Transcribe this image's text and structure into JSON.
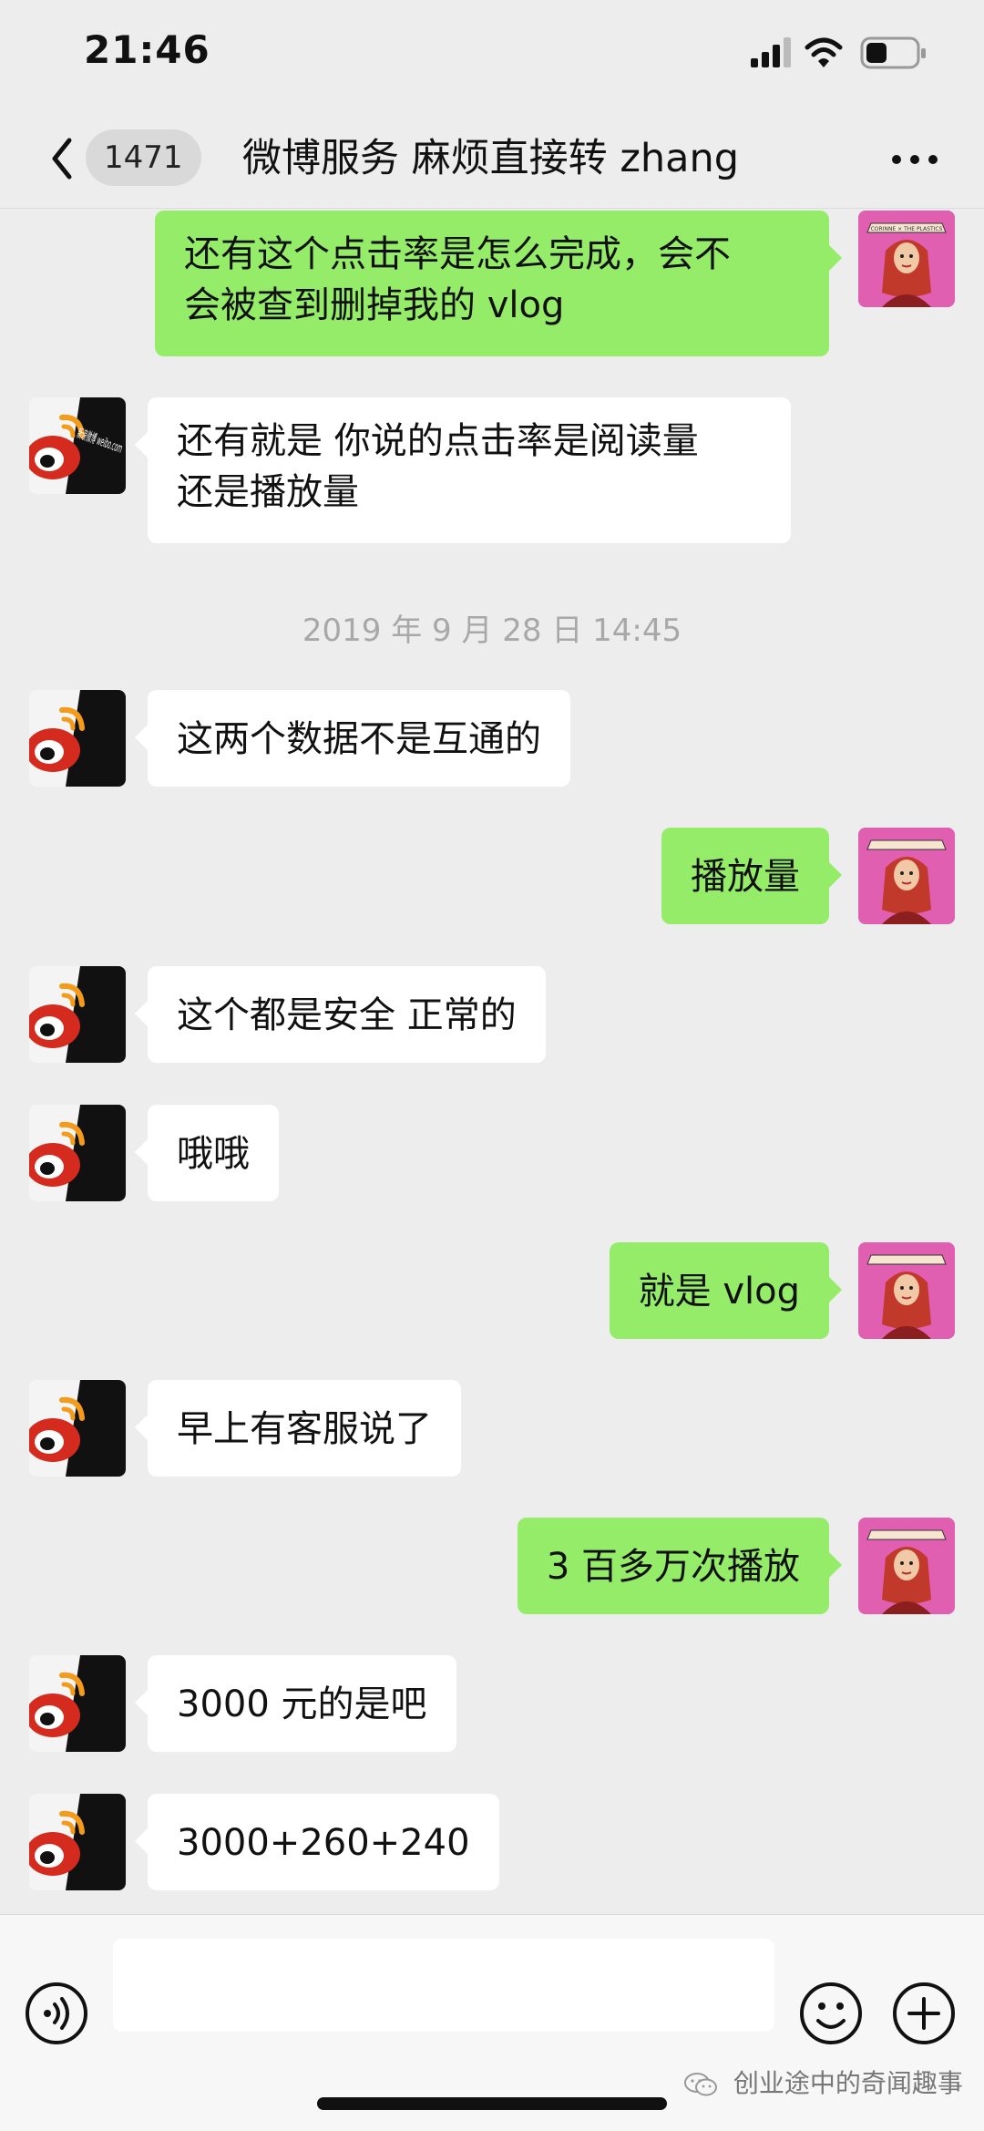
{
  "status_bar": {
    "time": "21:46"
  },
  "header": {
    "unread_count": "1471",
    "title": "微博服务 麻烦直接转 zhang"
  },
  "avatars": {
    "weibo_logo_text": "新浪微博 weibo.com",
    "self_logo_text": "CORINNE × THE PLASTICS"
  },
  "messages": [
    {
      "side": "out",
      "lines": [
        "还有这个点击率是怎么完成，会不",
        "会被查到删掉我的 vlog"
      ]
    },
    {
      "side": "in",
      "lines": [
        "还有就是 你说的点击率是阅读量",
        "还是播放量"
      ]
    },
    {
      "timestamp": "2019 年 9 月 28 日 14:45"
    },
    {
      "side": "in",
      "text": "这两个数据不是互通的"
    },
    {
      "side": "out",
      "text": "播放量"
    },
    {
      "side": "in",
      "text": "这个都是安全 正常的"
    },
    {
      "side": "in",
      "text": "哦哦"
    },
    {
      "side": "out",
      "text": "就是 vlog"
    },
    {
      "side": "in",
      "text": "早上有客服说了"
    },
    {
      "side": "out",
      "text": "3 百多万次播放"
    },
    {
      "side": "in",
      "text": "3000 元的是吧"
    },
    {
      "side": "in",
      "text": "3000+260+240"
    }
  ],
  "input_bar": {
    "value": ""
  },
  "watermark": {
    "text": "创业途中的奇闻趣事"
  },
  "colors": {
    "background": "#ededed",
    "bubble_out": "#95ec69",
    "bubble_in": "#ffffff",
    "self_avatar": "#e05fb1",
    "weibo_red": "#d52b1e",
    "weibo_orange": "#f59b1b"
  }
}
